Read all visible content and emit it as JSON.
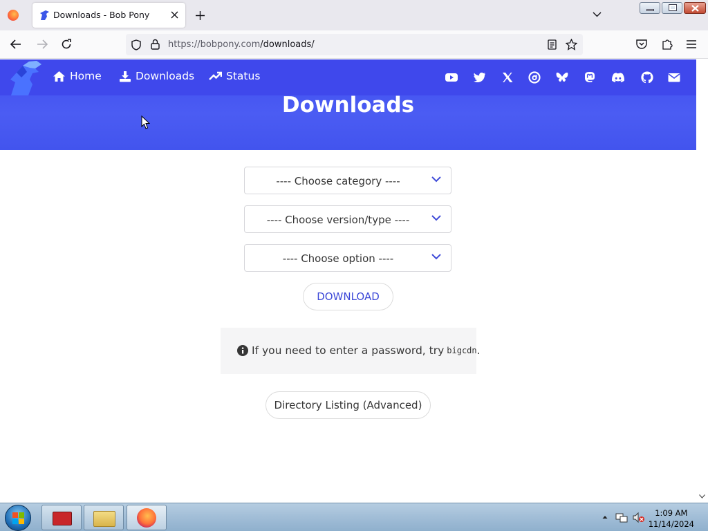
{
  "browser": {
    "tab_title": "Downloads - Bob Pony",
    "url_host": "https://bobpony.com",
    "url_path": "/downloads/"
  },
  "site_nav": {
    "links": [
      {
        "label": "Home",
        "icon": "home-icon"
      },
      {
        "label": "Downloads",
        "icon": "download-icon"
      },
      {
        "label": "Status",
        "icon": "trending-up-icon"
      }
    ],
    "social_icons": [
      "youtube-icon",
      "twitter-icon",
      "x-icon",
      "threads-icon",
      "bluesky-icon",
      "mastodon-icon",
      "discord-icon",
      "github-icon",
      "mail-icon"
    ]
  },
  "hero": {
    "title": "Downloads"
  },
  "form": {
    "category_placeholder": "---- Choose category ----",
    "version_placeholder": "---- Choose version/type ----",
    "option_placeholder": "---- Choose option ----",
    "download_label": "DOWNLOAD"
  },
  "notice": {
    "text": "If you need to enter a password, try",
    "code": "bigcdn",
    "suffix": "."
  },
  "directory_button": "Directory Listing (Advanced)",
  "taskbar": {
    "time": "1:09 AM",
    "date": "11/14/2024"
  },
  "colors": {
    "brand_blue": "#3f48ec",
    "link_blue": "#3e4ad8"
  }
}
